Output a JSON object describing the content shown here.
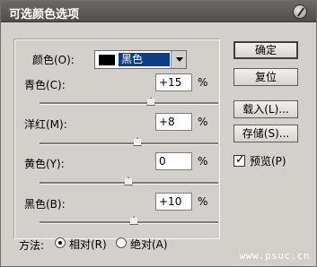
{
  "window": {
    "title": "可选颜色选项"
  },
  "colors_label": "颜色(O):",
  "selected_color": "黑色",
  "percent_sign": "%",
  "sliders": [
    {
      "label": "青色(C):",
      "value": "+15",
      "slider_position": 0.615
    },
    {
      "label": "洋红(M):",
      "value": "+8",
      "slider_position": 0.545
    },
    {
      "label": "黄色(Y):",
      "value": "0",
      "slider_position": 0.5
    },
    {
      "label": "黑色(B):",
      "value": "+10",
      "slider_position": 0.56
    }
  ],
  "buttons": {
    "ok": "确定",
    "reset": "复位",
    "load": "载入(L)...",
    "save": "存储(S)...",
    "preview": "预览(P)"
  },
  "method": {
    "label": "方法:",
    "relative": "相对(R)",
    "absolute": "绝对(A)",
    "selected": "relative"
  },
  "watermark": "www.psuc.cn"
}
